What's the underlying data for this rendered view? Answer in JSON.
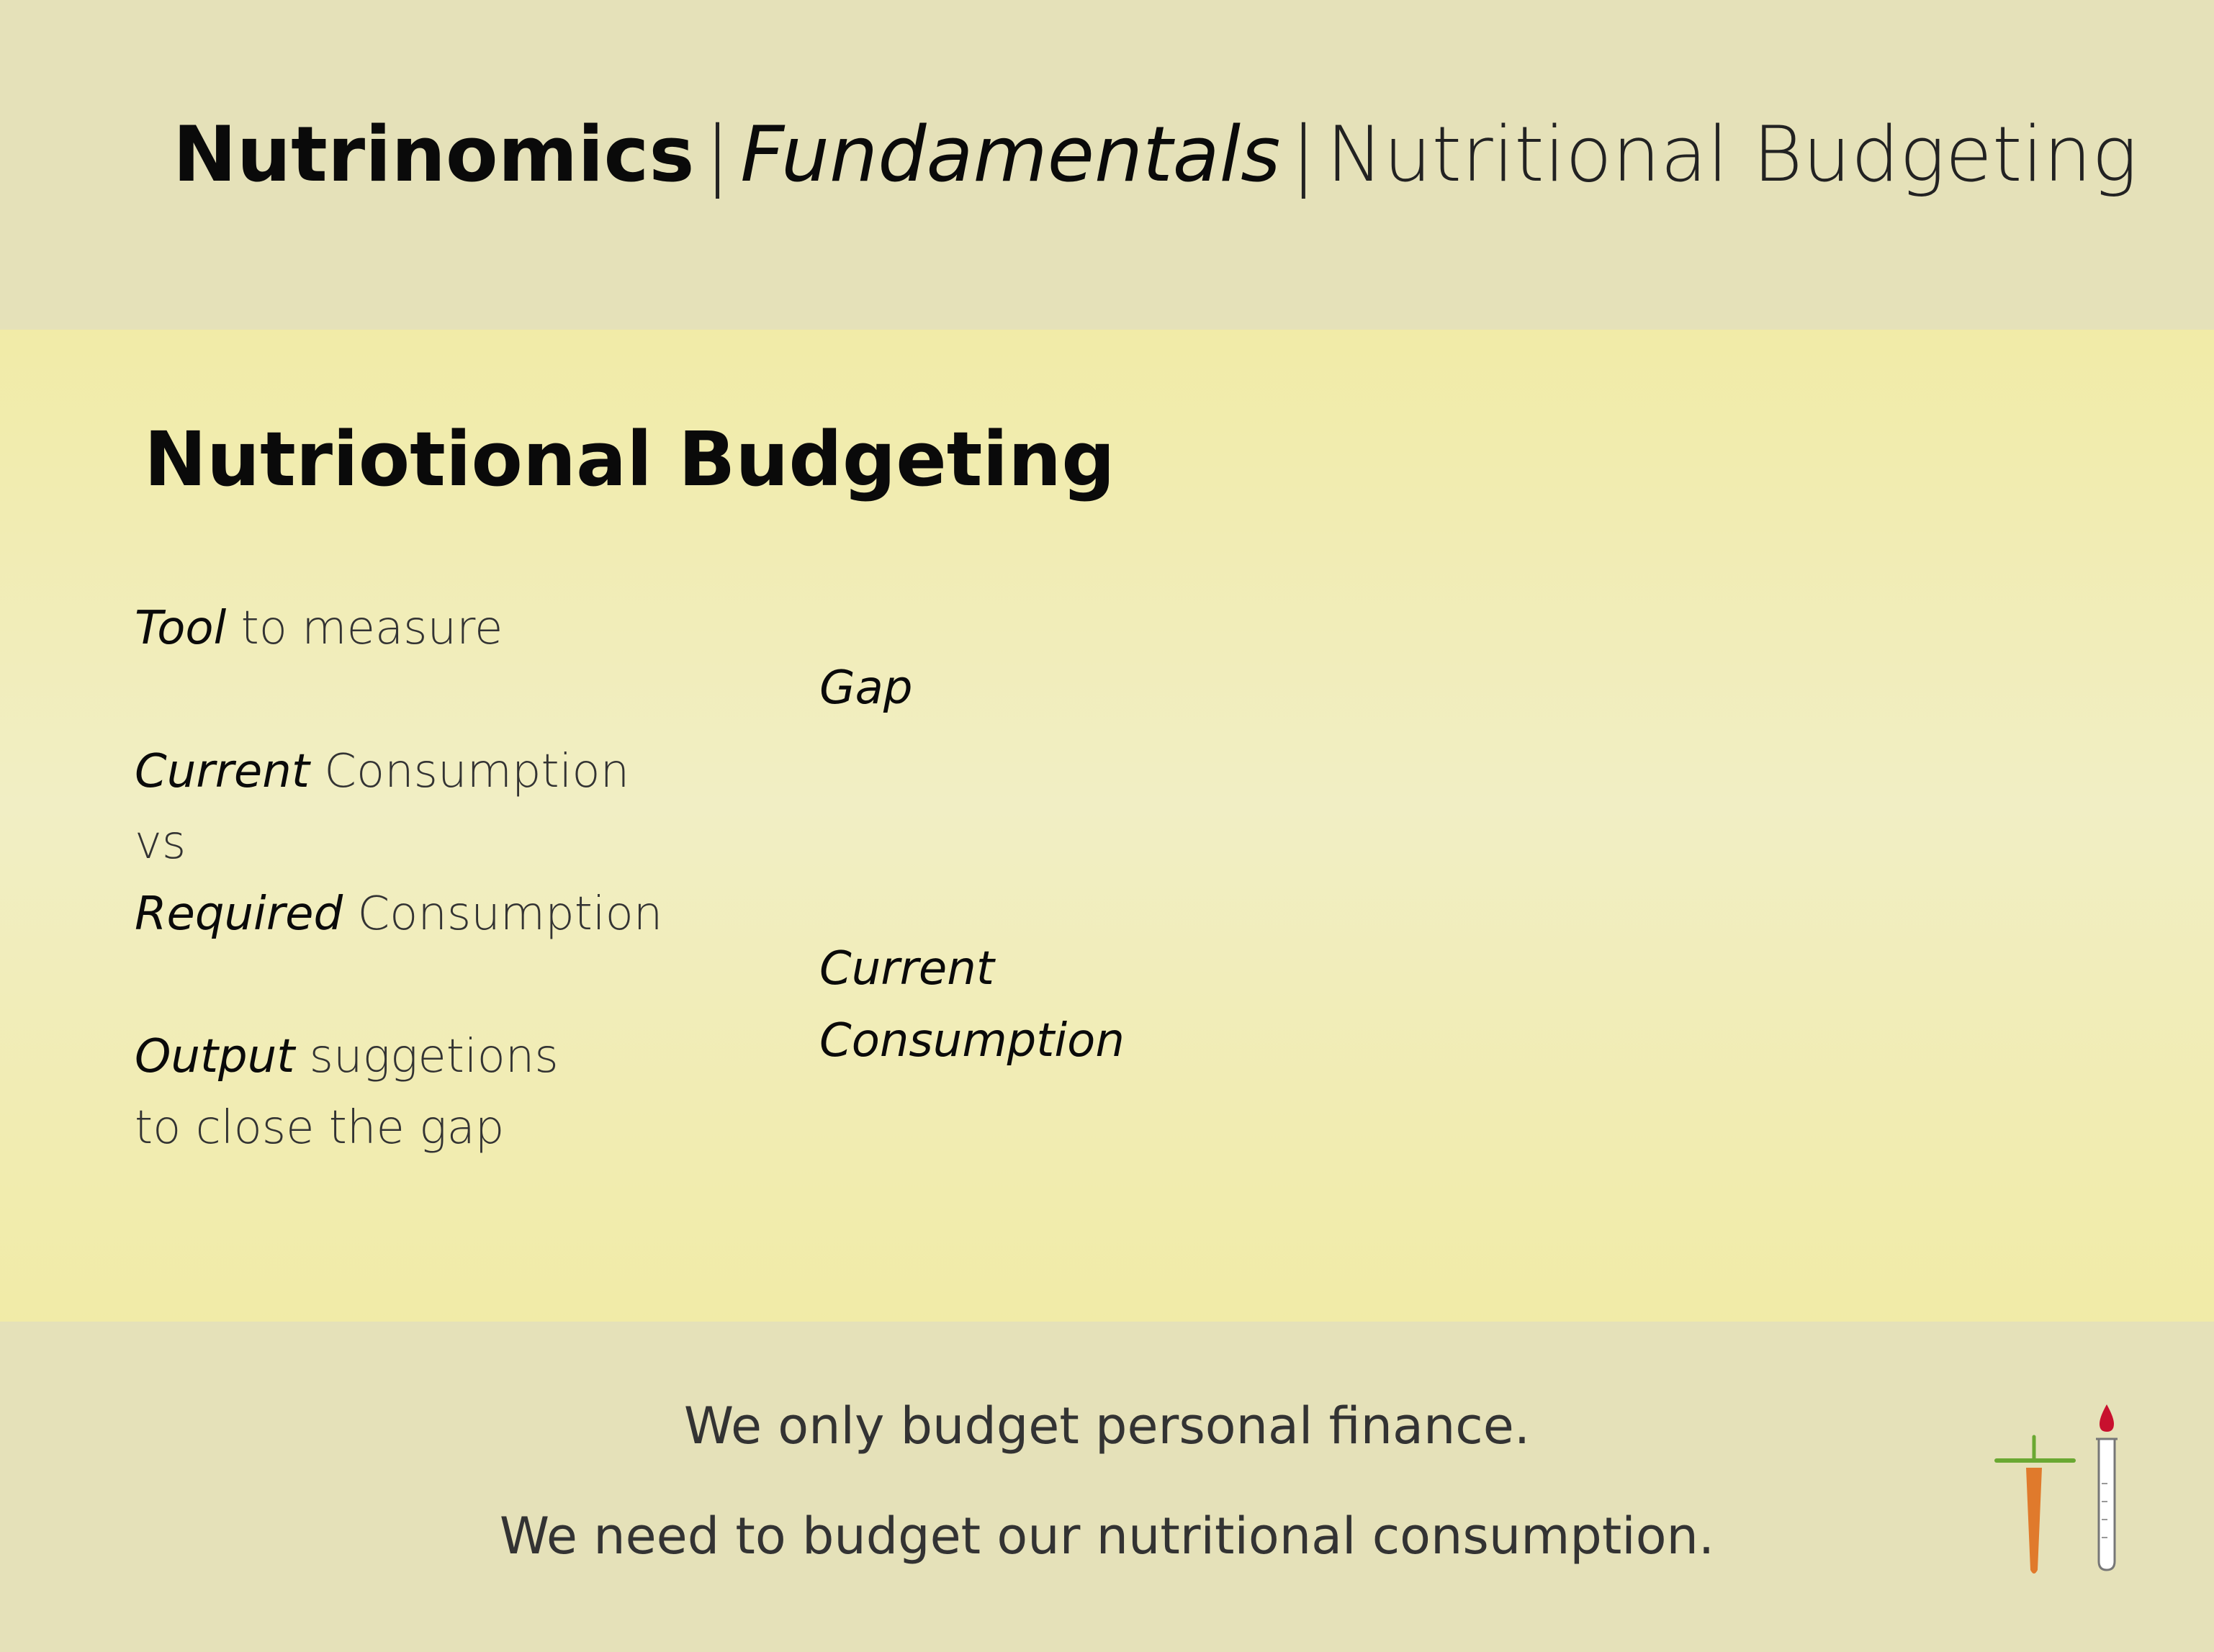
{
  "header": {
    "brand": "Nutrinomics",
    "separator": "|",
    "section": "Fundamentals",
    "topic": "Nutritional Budgeting"
  },
  "main": {
    "title": "Nutriotional Budgeting",
    "points": [
      {
        "emphasis": "Tool",
        "text": " to measure"
      },
      {
        "emphasis": "Current",
        "text": " Consumption"
      },
      {
        "emphasis": "",
        "text": "vs"
      },
      {
        "emphasis": "Required",
        "text": " Consumption"
      },
      {
        "emphasis": "Output",
        "text": " suggetions"
      },
      {
        "emphasis": "",
        "text": "to close the gap"
      }
    ],
    "diagram_labels": {
      "gap": "Gap",
      "current_line1": "Current",
      "current_line2": "Consumption"
    }
  },
  "footer": {
    "line1": "We only budget personal finance.",
    "line2": "We need to budget our nutritional consumption.",
    "logo_icon": "carrot-and-test-tube-icon",
    "colors": {
      "carrot": "#e07a2c",
      "leaf": "#6aa832",
      "drop": "#c8102e"
    }
  }
}
